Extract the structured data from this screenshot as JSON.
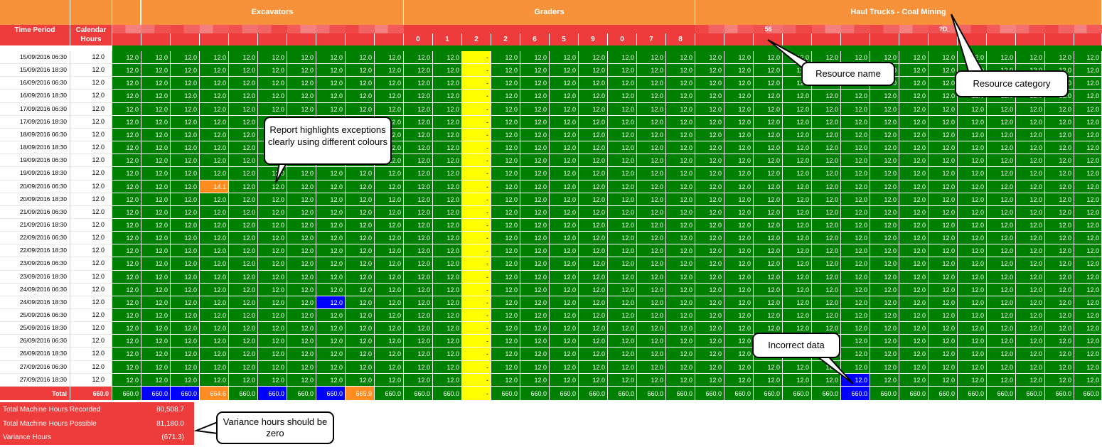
{
  "header": {
    "time_period_label": "Time Period",
    "calendar_hours_label": "Calendar\nHours",
    "categories": [
      {
        "name": "Excavators",
        "span": 10
      },
      {
        "name": "Graders",
        "span": 10
      },
      {
        "name": "Haul Trucks - Coal Mining",
        "span": 14
      }
    ],
    "grader_resource_names": [
      "0",
      "1",
      "2",
      "2",
      "6",
      "5",
      "9",
      "0",
      "7",
      "8"
    ],
    "truck_resource_labels": [
      {
        "column": 2,
        "text": "56"
      },
      {
        "column": 8,
        "text": "?D"
      }
    ]
  },
  "rows": [
    {
      "time": "15/09/2016 06:30",
      "calendar": "12.0"
    },
    {
      "time": "15/09/2016 18:30",
      "calendar": "12.0"
    },
    {
      "time": "16/09/2016 06:30",
      "calendar": "12.0"
    },
    {
      "time": "16/09/2016 18:30",
      "calendar": "12.0"
    },
    {
      "time": "17/09/2016 06:30",
      "calendar": "12.0"
    },
    {
      "time": "17/09/2016 18:30",
      "calendar": "12.0"
    },
    {
      "time": "18/09/2016 06:30",
      "calendar": "12.0"
    },
    {
      "time": "18/09/2016 18:30",
      "calendar": "12.0"
    },
    {
      "time": "19/09/2016 06:30",
      "calendar": "12.0"
    },
    {
      "time": "19/09/2016 18:30",
      "calendar": "12.0"
    },
    {
      "time": "20/09/2016 06:30",
      "calendar": "12.0"
    },
    {
      "time": "20/09/2016 18:30",
      "calendar": "12.0"
    },
    {
      "time": "21/09/2016 06:30",
      "calendar": "12.0"
    },
    {
      "time": "21/09/2016 18:30",
      "calendar": "12.0"
    },
    {
      "time": "22/09/2016 06:30",
      "calendar": "12.0"
    },
    {
      "time": "22/09/2016 18:30",
      "calendar": "12.0"
    },
    {
      "time": "23/09/2016 06:30",
      "calendar": "12.0"
    },
    {
      "time": "23/09/2016 18:30",
      "calendar": "12.0"
    },
    {
      "time": "24/09/2016 06:30",
      "calendar": "12.0"
    },
    {
      "time": "24/09/2016 18:30",
      "calendar": "12.0"
    },
    {
      "time": "25/09/2016 06:30",
      "calendar": "12.0"
    },
    {
      "time": "25/09/2016 18:30",
      "calendar": "12.0"
    },
    {
      "time": "26/09/2016 06:30",
      "calendar": "12.0"
    },
    {
      "time": "26/09/2016 18:30",
      "calendar": "12.0"
    },
    {
      "time": "27/09/2016 06:30",
      "calendar": "12.0"
    },
    {
      "time": "27/09/2016 18:30",
      "calendar": "12.0"
    }
  ],
  "cell_default_value": "12.0",
  "missing_value": "-",
  "missing_column": 12,
  "exceptions": [
    {
      "row": 10,
      "col": 3,
      "value": "14.1",
      "status": "over"
    },
    {
      "row": 19,
      "col": 7,
      "value": "12.0",
      "status": "incorrect"
    },
    {
      "row": 25,
      "col": 25,
      "value": "12.0",
      "status": "incorrect"
    }
  ],
  "totals": {
    "label": "Total",
    "calendar": "660.0",
    "values": [
      "660.0",
      "660.0",
      "660.0",
      "664.6",
      "660.0",
      "660.0",
      "660.0",
      "660.0",
      "665.9",
      "660.0",
      "660.0",
      "660.0",
      "-",
      "660.0",
      "660.0",
      "660.0",
      "660.0",
      "660.0",
      "660.0",
      "660.0",
      "660.0",
      "660.0",
      "660.0",
      "660.0",
      "660.0",
      "660.0",
      "660.0",
      "660.0",
      "660.0",
      "660.0",
      "660.0",
      "660.0",
      "660.0",
      "660.0"
    ],
    "statuses": [
      "ok",
      "incorrect",
      "incorrect",
      "over",
      "ok",
      "incorrect",
      "ok",
      "incorrect",
      "over",
      "ok",
      "ok",
      "ok",
      "missing",
      "ok",
      "ok",
      "ok",
      "ok",
      "ok",
      "ok",
      "ok",
      "ok",
      "ok",
      "ok",
      "ok",
      "ok",
      "incorrect",
      "ok",
      "ok",
      "ok",
      "ok",
      "ok",
      "ok",
      "ok",
      "ok"
    ]
  },
  "summary": [
    {
      "label": "Total Machine Hours Recorded",
      "value": "80,508.7"
    },
    {
      "label": "Total Machine Hours Possible",
      "value": "81,180.0"
    },
    {
      "label": "Variance Hours",
      "value": "(671.3)"
    }
  ],
  "callouts": {
    "exceptions": "Report highlights exceptions clearly using different colours",
    "resource_name": "Resource name",
    "resource_category": "Resource category",
    "incorrect_data": "Incorrect data",
    "variance": "Variance hours should be zero"
  },
  "colors": {
    "ok": "#008000",
    "missing": "#ffff00",
    "over": "#ff8c21",
    "incorrect": "#0000ff",
    "header_category": "#f7923a",
    "header_resource": "#ee3b3b"
  }
}
